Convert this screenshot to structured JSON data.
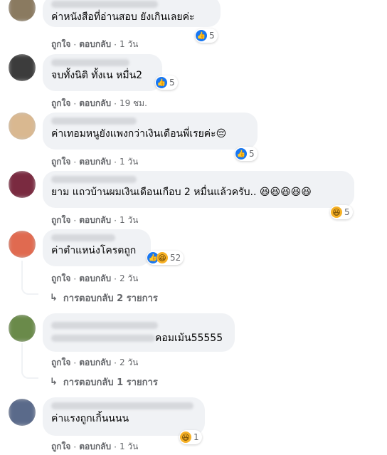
{
  "comments": [
    {
      "text": "ค่าหนังสือที่อ่านสอบ ยังเกินเลยค่ะ",
      "emoji": "",
      "reaction_count": "5",
      "reactions": [
        "like-icon"
      ],
      "like": "ถูกใจ",
      "reply": "ตอบกลับ",
      "time": "1 วัน"
    },
    {
      "text": "จบทั้งนิติ ทั้งเน หมื่น2",
      "emoji": "",
      "reaction_count": "5",
      "reactions": [
        "like-icon"
      ],
      "like": "ถูกใจ",
      "reply": "ตอบกลับ",
      "time": "19 ชม."
    },
    {
      "text": "ค่าเทอมหนูยังแพงกว่าเงินเดือนพี่เรยค่ะ",
      "emoji": "😔",
      "reaction_count": "5",
      "reactions": [
        "like-icon"
      ],
      "like": "ถูกใจ",
      "reply": "ตอบกลับ",
      "time": "1 วัน"
    },
    {
      "text": "ยาม แถวบ้านผมเงินเดือนเกือบ 2 หมื่นแล้วครับ..",
      "emoji": "😆😆😆😆😆",
      "reaction_count": "5",
      "reactions": [
        "haha-icon"
      ],
      "like": "ถูกใจ",
      "reply": "ตอบกลับ",
      "time": "1 วัน"
    },
    {
      "text": "ค่าตำแหน่งโครตถูก",
      "emoji": "",
      "reaction_count": "52",
      "reactions": [
        "like-icon",
        "haha-icon"
      ],
      "like": "ถูกใจ",
      "reply": "ตอบกลับ",
      "time": "2 วัน",
      "replies_label": "การตอบกลับ 2 รายการ"
    },
    {
      "text": "คอมเม้น55555",
      "emoji": "",
      "reaction_count": "",
      "reactions": [],
      "like": "ถูกใจ",
      "reply": "ตอบกลับ",
      "time": "2 วัน",
      "replies_label": "การตอบกลับ 1 รายการ"
    },
    {
      "text": "ค่าแรงถูกเกิ้นนนน",
      "emoji": "",
      "reaction_count": "1",
      "reactions": [
        "haha-icon"
      ],
      "like": "ถูกใจ",
      "reply": "ตอบกลับ",
      "time": "1 วัน"
    }
  ],
  "colors": {
    "bubble": "#f0f2f5",
    "meta_text": "#65676b",
    "like_blue": "#1877f2",
    "haha_yellow": "#f7b125"
  }
}
